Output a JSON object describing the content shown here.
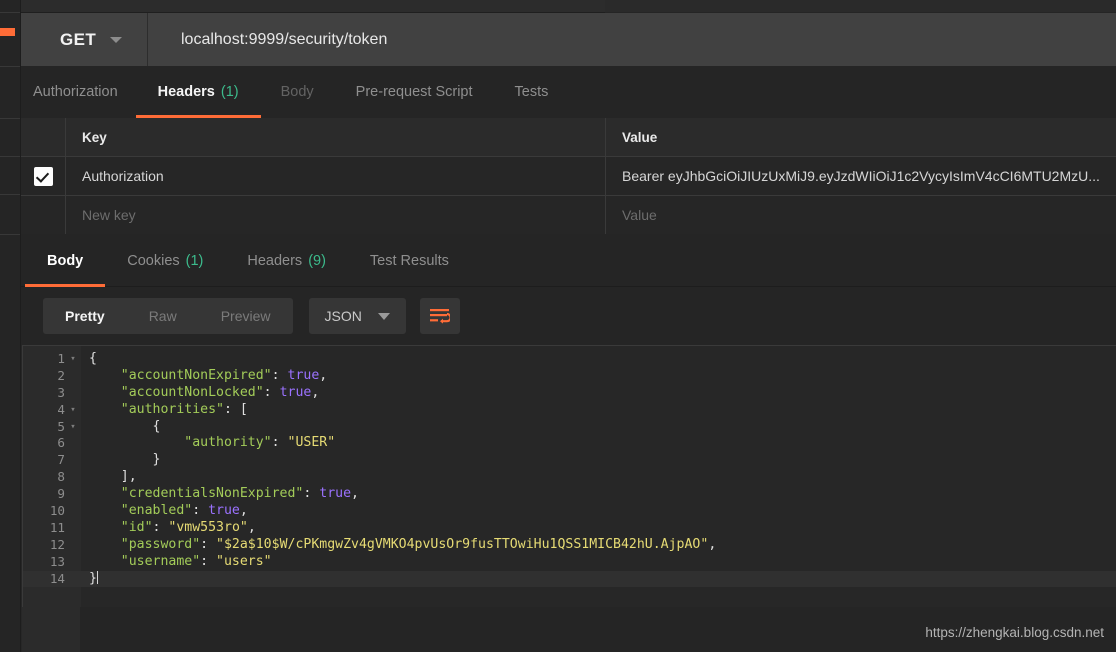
{
  "window": {
    "watermark": "https://zhengkai.blog.csdn.net"
  },
  "request_bar": {
    "method": "GET",
    "url": "localhost:9999/security/token"
  },
  "request_tabs": [
    {
      "label": "Authorization",
      "count": "",
      "state": "normal"
    },
    {
      "label": "Headers",
      "count": "(1)",
      "state": "active"
    },
    {
      "label": "Body",
      "count": "",
      "state": "dim"
    },
    {
      "label": "Pre-request Script",
      "count": "",
      "state": "normal"
    },
    {
      "label": "Tests",
      "count": "",
      "state": "normal"
    }
  ],
  "headers_table": {
    "columns": {
      "key": "Key",
      "value": "Value"
    },
    "rows": [
      {
        "checked": true,
        "key": "Authorization",
        "value": "Bearer eyJhbGciOiJIUzUxMiJ9.eyJzdWIiOiJ1c2VycyIsImV4cCI6MTU2MzU..."
      }
    ],
    "new_row": {
      "key_placeholder": "New key",
      "value_placeholder": "Value"
    }
  },
  "response_tabs": [
    {
      "label": "Body",
      "count": "",
      "state": "active"
    },
    {
      "label": "Cookies",
      "count": "(1)",
      "state": "normal"
    },
    {
      "label": "Headers",
      "count": "(9)",
      "state": "normal"
    },
    {
      "label": "Test Results",
      "count": "",
      "state": "normal"
    }
  ],
  "response_toolbar": {
    "view_modes": [
      {
        "label": "Pretty",
        "active": true
      },
      {
        "label": "Raw",
        "active": false
      },
      {
        "label": "Preview",
        "active": false
      }
    ],
    "format": "JSON",
    "wrap_icon": "word-wrap-icon"
  },
  "response_body": {
    "lines": [
      {
        "n": "1",
        "fold": "▾",
        "highlight": false,
        "tokens": [
          {
            "t": "{",
            "c": "tok-punc"
          }
        ]
      },
      {
        "n": "2",
        "fold": "",
        "highlight": false,
        "tokens": [
          {
            "t": "    \"accountNonExpired\"",
            "c": "tok-key"
          },
          {
            "t": ": ",
            "c": "tok-punc"
          },
          {
            "t": "true",
            "c": "tok-bool"
          },
          {
            "t": ",",
            "c": "tok-punc"
          }
        ]
      },
      {
        "n": "3",
        "fold": "",
        "highlight": false,
        "tokens": [
          {
            "t": "    \"accountNonLocked\"",
            "c": "tok-key"
          },
          {
            "t": ": ",
            "c": "tok-punc"
          },
          {
            "t": "true",
            "c": "tok-bool"
          },
          {
            "t": ",",
            "c": "tok-punc"
          }
        ]
      },
      {
        "n": "4",
        "fold": "▾",
        "highlight": false,
        "tokens": [
          {
            "t": "    \"authorities\"",
            "c": "tok-key"
          },
          {
            "t": ": [",
            "c": "tok-punc"
          }
        ]
      },
      {
        "n": "5",
        "fold": "▾",
        "highlight": false,
        "tokens": [
          {
            "t": "        {",
            "c": "tok-punc"
          }
        ]
      },
      {
        "n": "6",
        "fold": "",
        "highlight": false,
        "tokens": [
          {
            "t": "            \"authority\"",
            "c": "tok-key"
          },
          {
            "t": ": ",
            "c": "tok-punc"
          },
          {
            "t": "\"USER\"",
            "c": "tok-str"
          }
        ]
      },
      {
        "n": "7",
        "fold": "",
        "highlight": false,
        "tokens": [
          {
            "t": "        }",
            "c": "tok-punc"
          }
        ]
      },
      {
        "n": "8",
        "fold": "",
        "highlight": false,
        "tokens": [
          {
            "t": "    ],",
            "c": "tok-punc"
          }
        ]
      },
      {
        "n": "9",
        "fold": "",
        "highlight": false,
        "tokens": [
          {
            "t": "    \"credentialsNonExpired\"",
            "c": "tok-key"
          },
          {
            "t": ": ",
            "c": "tok-punc"
          },
          {
            "t": "true",
            "c": "tok-bool"
          },
          {
            "t": ",",
            "c": "tok-punc"
          }
        ]
      },
      {
        "n": "10",
        "fold": "",
        "highlight": false,
        "tokens": [
          {
            "t": "    \"enabled\"",
            "c": "tok-key"
          },
          {
            "t": ": ",
            "c": "tok-punc"
          },
          {
            "t": "true",
            "c": "tok-bool"
          },
          {
            "t": ",",
            "c": "tok-punc"
          }
        ]
      },
      {
        "n": "11",
        "fold": "",
        "highlight": false,
        "tokens": [
          {
            "t": "    \"id\"",
            "c": "tok-key"
          },
          {
            "t": ": ",
            "c": "tok-punc"
          },
          {
            "t": "\"vmw553ro\"",
            "c": "tok-str"
          },
          {
            "t": ",",
            "c": "tok-punc"
          }
        ]
      },
      {
        "n": "12",
        "fold": "",
        "highlight": false,
        "tokens": [
          {
            "t": "    \"password\"",
            "c": "tok-key"
          },
          {
            "t": ": ",
            "c": "tok-punc"
          },
          {
            "t": "\"$2a$10$W/cPKmgwZv4gVMKO4pvUsOr9fusTTOwiHu1QSS1MICB42hU.AjpAO\"",
            "c": "tok-str"
          },
          {
            "t": ",",
            "c": "tok-punc"
          }
        ]
      },
      {
        "n": "13",
        "fold": "",
        "highlight": false,
        "tokens": [
          {
            "t": "    \"username\"",
            "c": "tok-key"
          },
          {
            "t": ": ",
            "c": "tok-punc"
          },
          {
            "t": "\"users\"",
            "c": "tok-str"
          }
        ]
      },
      {
        "n": "14",
        "fold": "",
        "highlight": true,
        "tokens": [
          {
            "t": "}",
            "c": "tok-punc"
          }
        ]
      }
    ]
  },
  "colors": {
    "accent": "#ff6c37",
    "count_green": "#3cbb8c",
    "json_key": "#a3cc59",
    "json_string": "#e6db74",
    "json_boolean": "#9b72ff"
  }
}
